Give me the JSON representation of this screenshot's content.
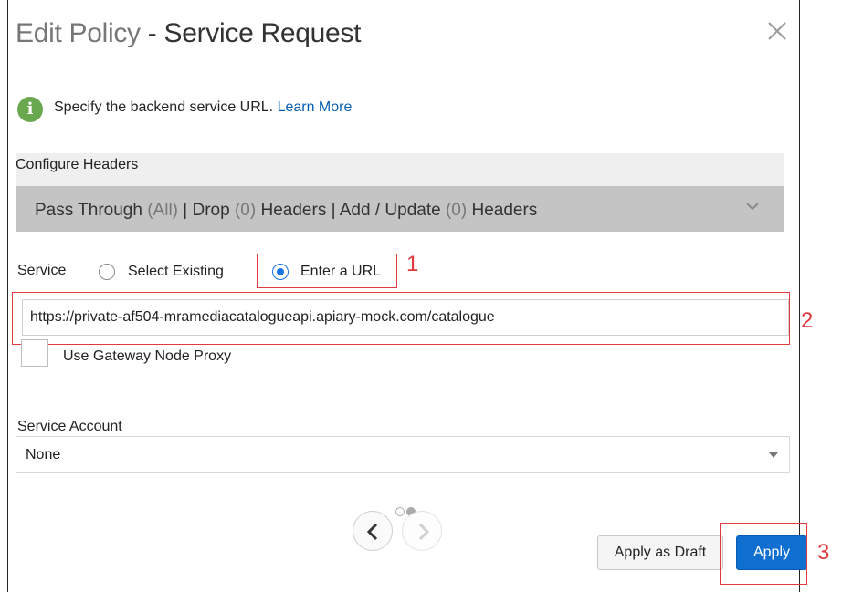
{
  "dialog": {
    "title_prefix": "Edit Policy",
    "title_suffix": " - Service Request",
    "close_icon": "close-icon"
  },
  "info": {
    "icon_text": "i",
    "text": "Specify the backend service URL. ",
    "link": "Learn More"
  },
  "headers": {
    "label": "Configure Headers",
    "pass_through": "Pass Through ",
    "pass_through_count": "(All)",
    "sep1": " | Drop ",
    "drop_count": "(0)",
    "headers_word1": " Headers | Add / Update ",
    "update_count": "(0)",
    "headers_word2": " Headers"
  },
  "service": {
    "label": "Service",
    "option_existing": "Select Existing",
    "option_url": "Enter a URL",
    "selected": "Enter a URL",
    "url_value": "https://private-af504-mramediacatalogueapi.apiary-mock.com/catalogue",
    "proxy_label": "Use Gateway Node Proxy",
    "proxy_checked": false
  },
  "account": {
    "label": "Service Account",
    "value": "None"
  },
  "pager": {
    "total": 2,
    "current": 2
  },
  "buttons": {
    "draft": "Apply as Draft",
    "apply": "Apply"
  },
  "annotations": {
    "one": "1",
    "two": "2",
    "three": "3"
  },
  "colors": {
    "accent": "#0f6fd0",
    "info_green": "#6aa84f",
    "annotation_red": "#e0393e"
  }
}
